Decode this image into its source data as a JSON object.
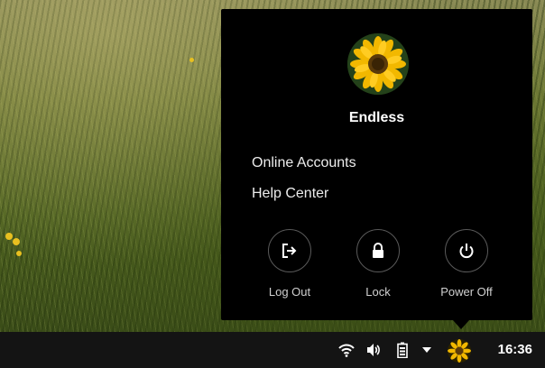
{
  "system_menu": {
    "user_name": "Endless",
    "items": [
      {
        "label": "Online Accounts"
      },
      {
        "label": "Help Center"
      }
    ],
    "actions": [
      {
        "label": "Log Out",
        "icon": "log-out-icon"
      },
      {
        "label": "Lock",
        "icon": "lock-icon"
      },
      {
        "label": "Power Off",
        "icon": "power-icon"
      }
    ]
  },
  "taskbar": {
    "clock": "16:36",
    "tray_icons": [
      "wifi-icon",
      "volume-icon",
      "battery-icon",
      "dropdown-arrow-icon",
      "user-avatar-icon"
    ]
  },
  "colors": {
    "menu_background": "#000000",
    "taskbar_background": "#141414",
    "sunflower_petal": "#f2b800",
    "sunflower_center": "#5a3a0a"
  }
}
